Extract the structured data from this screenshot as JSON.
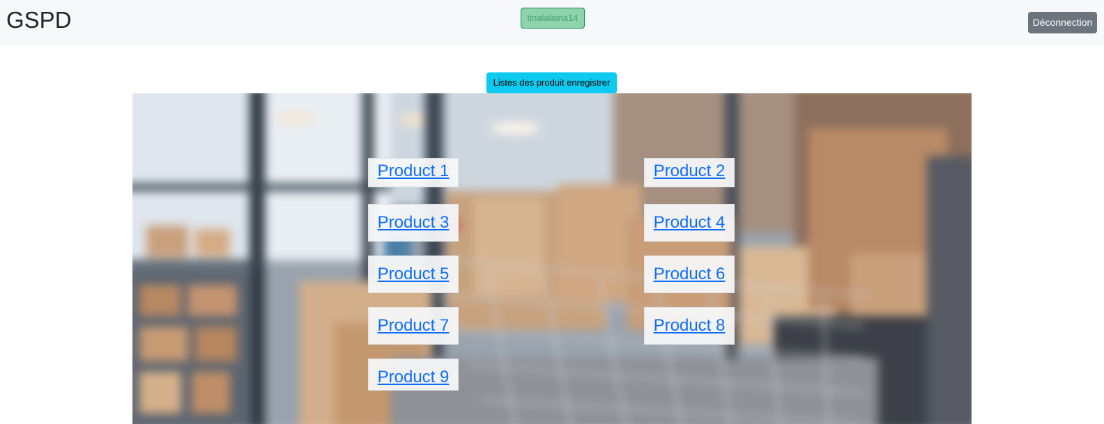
{
  "navbar": {
    "brand": "GSPD",
    "username": "tinalalaina14",
    "logout_label": "Déconnection"
  },
  "actions": {
    "list_button_label": "Listes des produit enregistrer"
  },
  "products": [
    {
      "label": "Product 1"
    },
    {
      "label": "Product 2"
    },
    {
      "label": "Product 3"
    },
    {
      "label": "Product 4"
    },
    {
      "label": "Product 5"
    },
    {
      "label": "Product 6"
    },
    {
      "label": "Product 7"
    },
    {
      "label": "Product 8"
    },
    {
      "label": "Product 9"
    }
  ],
  "colors": {
    "navbar_bg": "#f7f8f9",
    "badge_border": "#198754",
    "logout_bg": "#6c757d",
    "list_button_bg": "#0dcaf0",
    "link": "#0d6efd"
  }
}
